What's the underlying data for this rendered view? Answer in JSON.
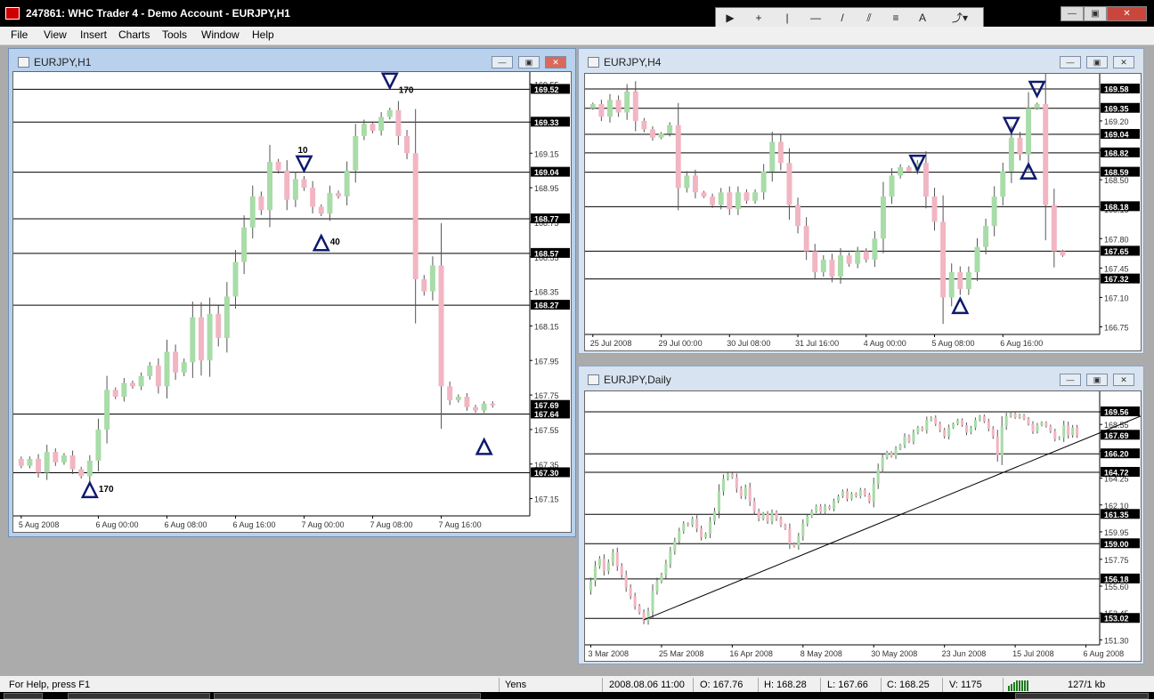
{
  "app": {
    "title": "247861: WHC Trader 4 - Demo Account - EURJPY,H1"
  },
  "menu": [
    "File",
    "View",
    "Insert",
    "Charts",
    "Tools",
    "Window",
    "Help"
  ],
  "toolbar": {
    "tools": [
      "cursor-icon",
      "crosshair-icon",
      "vertical-line-icon",
      "horizontal-line-icon",
      "trendline-icon",
      "channel-icon",
      "fibonacci-icon",
      "text-icon",
      "arrow-icon"
    ],
    "glyphs": [
      "▶",
      "+",
      "|",
      "—",
      "/",
      "⫽",
      "≡",
      "A",
      "⤴▾"
    ]
  },
  "window_buttons": {
    "minimize": "—",
    "restore": "▣",
    "close": "✕"
  },
  "chart_window_buttons": {
    "minimize": "—",
    "restore": "▣",
    "close": "✕"
  },
  "colors": {
    "bull": "#a8dca8",
    "bear": "#f2b5c2",
    "marker": "#0e1a6e",
    "hline": "#000000"
  },
  "chart_data": [
    {
      "type": "candlestick",
      "title": "EURJPY,H1",
      "ylim": [
        167.05,
        169.62
      ],
      "y_ticks": [
        "169.55",
        "169.33",
        "169.15",
        "168.95",
        "168.75",
        "168.55",
        "168.35",
        "168.15",
        "167.95",
        "167.75",
        "167.55",
        "167.35",
        "167.15"
      ],
      "y_tick_values": [
        169.55,
        169.33,
        169.15,
        168.95,
        168.75,
        168.55,
        168.35,
        168.15,
        167.95,
        167.75,
        167.55,
        167.35,
        167.15
      ],
      "x_ticks": [
        "5 Aug 2008",
        "6 Aug 00:00",
        "6 Aug 08:00",
        "6 Aug 16:00",
        "7 Aug 00:00",
        "7 Aug 08:00",
        "7 Aug 16:00"
      ],
      "x_tick_index": [
        0,
        9,
        17,
        25,
        33,
        41,
        49
      ],
      "hlines": [
        {
          "value": 169.52,
          "label": "169.52"
        },
        {
          "value": 169.33,
          "label": "169.33"
        },
        {
          "value": 169.04,
          "label": "169.04"
        },
        {
          "value": 168.77,
          "label": "168.77"
        },
        {
          "value": 168.57,
          "label": "168.57"
        },
        {
          "value": 168.27,
          "label": "168.27"
        },
        {
          "value": 167.64,
          "label": "167.64"
        },
        {
          "value": 167.3,
          "label": "167.30"
        }
      ],
      "current_price": {
        "value": 167.69,
        "label": "167.69"
      },
      "markers": [
        {
          "dir": "down",
          "index": 43,
          "value": 169.57,
          "label": "170"
        },
        {
          "dir": "down",
          "index": 33,
          "value": 169.09,
          "label": "10"
        },
        {
          "dir": "up",
          "index": 35,
          "value": 168.63,
          "label": "40"
        },
        {
          "dir": "up",
          "index": 54,
          "value": 167.45,
          "label": ""
        },
        {
          "dir": "up",
          "index": 8,
          "value": 167.2,
          "label": "170"
        }
      ],
      "closes": [
        167.34,
        167.38,
        167.3,
        167.42,
        167.36,
        167.4,
        167.32,
        167.28,
        167.37,
        167.55,
        167.78,
        167.74,
        167.82,
        167.8,
        167.86,
        167.92,
        167.8,
        168.0,
        167.88,
        167.94,
        168.2,
        167.95,
        168.22,
        168.08,
        168.32,
        168.52,
        168.72,
        168.9,
        168.82,
        169.1,
        169.05,
        168.88,
        169.0,
        168.95,
        168.84,
        168.8,
        168.92,
        168.9,
        169.05,
        169.25,
        169.32,
        169.28,
        169.36,
        169.4,
        169.25,
        169.15,
        168.42,
        168.35,
        168.5,
        167.8,
        167.72,
        167.74,
        167.68,
        167.66,
        167.7,
        167.69
      ],
      "open": 167.38
    },
    {
      "type": "candlestick",
      "title": "EURJPY,H4",
      "ylim": [
        166.66,
        169.76
      ],
      "y_ticks": [
        "169.20",
        "168.85",
        "168.50",
        "168.15",
        "167.80",
        "167.45",
        "167.10",
        "166.75"
      ],
      "y_tick_values": [
        169.2,
        168.85,
        168.5,
        168.15,
        167.8,
        167.45,
        167.1,
        166.75
      ],
      "x_ticks": [
        "25 Jul 2008",
        "29 Jul 00:00",
        "30 Jul 08:00",
        "31 Jul 16:00",
        "4 Aug 00:00",
        "5 Aug 08:00",
        "6 Aug 16:00"
      ],
      "x_tick_index": [
        0,
        8,
        16,
        24,
        32,
        40,
        48
      ],
      "hlines": [
        {
          "value": 169.58,
          "label": "169.58"
        },
        {
          "value": 169.35,
          "label": "169.35"
        },
        {
          "value": 169.04,
          "label": "169.04"
        },
        {
          "value": 168.82,
          "label": "168.82"
        },
        {
          "value": 168.59,
          "label": "168.59"
        },
        {
          "value": 168.18,
          "label": "168.18"
        },
        {
          "value": 167.65,
          "label": "167.65"
        },
        {
          "value": 167.32,
          "label": "167.32"
        }
      ],
      "current_price": {
        "value": 167.65,
        "label": "167.65"
      },
      "markers": [
        {
          "dir": "down",
          "index": 38,
          "value": 168.7,
          "label": ""
        },
        {
          "dir": "down",
          "index": 49,
          "value": 169.15,
          "label": ""
        },
        {
          "dir": "down",
          "index": 52,
          "value": 169.58,
          "label": ""
        },
        {
          "dir": "up",
          "index": 51,
          "value": 168.6,
          "label": ""
        },
        {
          "dir": "up",
          "index": 43,
          "value": 167.0,
          "label": ""
        }
      ],
      "closes": [
        169.4,
        169.25,
        169.45,
        169.3,
        169.55,
        169.2,
        169.1,
        169.0,
        169.05,
        169.15,
        168.4,
        168.55,
        168.35,
        168.3,
        168.2,
        168.35,
        168.15,
        168.35,
        168.25,
        168.35,
        168.6,
        168.95,
        168.7,
        168.2,
        167.95,
        167.65,
        167.4,
        167.55,
        167.35,
        167.6,
        167.5,
        167.65,
        167.55,
        167.8,
        168.3,
        168.55,
        168.65,
        168.6,
        168.7,
        168.3,
        168.0,
        167.1,
        167.4,
        167.2,
        167.4,
        167.7,
        167.95,
        168.3,
        168.6,
        169.0,
        168.8,
        169.35,
        169.4,
        168.2,
        167.65,
        167.6
      ],
      "open": 169.35
    },
    {
      "type": "candlestick",
      "title": "EURJPY,Daily",
      "ylim": [
        150.9,
        171.2
      ],
      "y_ticks": [
        "169.56",
        "168.55",
        "166.40",
        "164.25",
        "162.10",
        "159.95",
        "157.75",
        "155.60",
        "153.45",
        "151.30"
      ],
      "y_tick_values": [
        169.56,
        168.55,
        166.4,
        164.25,
        162.1,
        159.95,
        157.75,
        155.6,
        153.45,
        151.3
      ],
      "x_ticks": [
        "3 Mar 2008",
        "25 Mar 2008",
        "16 Apr 2008",
        "8 May 2008",
        "30 May 2008",
        "23 Jun 2008",
        "15 Jul 2008",
        "6 Aug 2008"
      ],
      "x_tick_index": [
        0,
        16,
        32,
        48,
        64,
        80,
        96,
        112
      ],
      "hlines": [
        {
          "value": 169.56,
          "label": "169.56"
        },
        {
          "value": 166.2,
          "label": "166.20"
        },
        {
          "value": 164.72,
          "label": "164.72"
        },
        {
          "value": 161.35,
          "label": "161.35"
        },
        {
          "value": 159.0,
          "label": "159.00"
        },
        {
          "value": 156.18,
          "label": "156.18"
        },
        {
          "value": 153.02,
          "label": "153.02"
        }
      ],
      "current_price": {
        "value": 167.69,
        "label": "167.69"
      },
      "trendline": {
        "from": {
          "index": 12,
          "value": 152.9
        },
        "to": {
          "index": 127,
          "value": 169.6
        }
      },
      "markers": [],
      "closes": [
        156.0,
        157.2,
        157.8,
        156.8,
        157.5,
        158.3,
        157.2,
        156.5,
        155.5,
        154.8,
        154.0,
        153.5,
        152.8,
        153.6,
        155.2,
        156.0,
        156.5,
        157.4,
        158.4,
        159.2,
        160.0,
        160.6,
        160.5,
        161.0,
        160.2,
        159.5,
        159.8,
        160.8,
        161.6,
        163.2,
        164.2,
        164.6,
        164.3,
        163.4,
        162.8,
        163.5,
        162.4,
        161.6,
        161.0,
        161.4,
        160.8,
        161.5,
        161.0,
        160.5,
        160.2,
        159.0,
        158.8,
        159.6,
        160.6,
        161.2,
        161.6,
        162.0,
        161.5,
        162.0,
        161.8,
        162.4,
        162.8,
        163.2,
        162.6,
        163.0,
        162.8,
        163.3,
        162.9,
        162.4,
        163.8,
        165.0,
        165.9,
        166.3,
        166.0,
        166.6,
        166.9,
        167.6,
        167.2,
        167.9,
        168.3,
        168.1,
        168.9,
        169.1,
        168.6,
        168.1,
        167.6,
        168.3,
        168.6,
        168.9,
        168.5,
        167.9,
        168.3,
        168.9,
        169.2,
        168.8,
        168.2,
        167.6,
        166.1,
        168.4,
        169.2,
        169.4,
        169.1,
        169.3,
        169.0,
        168.6,
        168.0,
        168.5,
        168.7,
        168.4,
        168.0,
        167.4,
        167.5,
        168.5,
        167.7,
        168.3,
        167.69
      ],
      "open": 155.2
    }
  ],
  "windows": [
    {
      "title": "EURJPY,H1"
    },
    {
      "title": "EURJPY,H4"
    },
    {
      "title": "EURJPY,Daily"
    }
  ],
  "status": {
    "help": "For Help, press F1",
    "profile": "Yens",
    "datetime": "2008.08.06 11:00",
    "open": "O: 167.76",
    "high": "H: 168.28",
    "low": "L: 167.66",
    "close": "C: 168.25",
    "volume": "V: 1175",
    "traffic": "127/1 kb"
  }
}
